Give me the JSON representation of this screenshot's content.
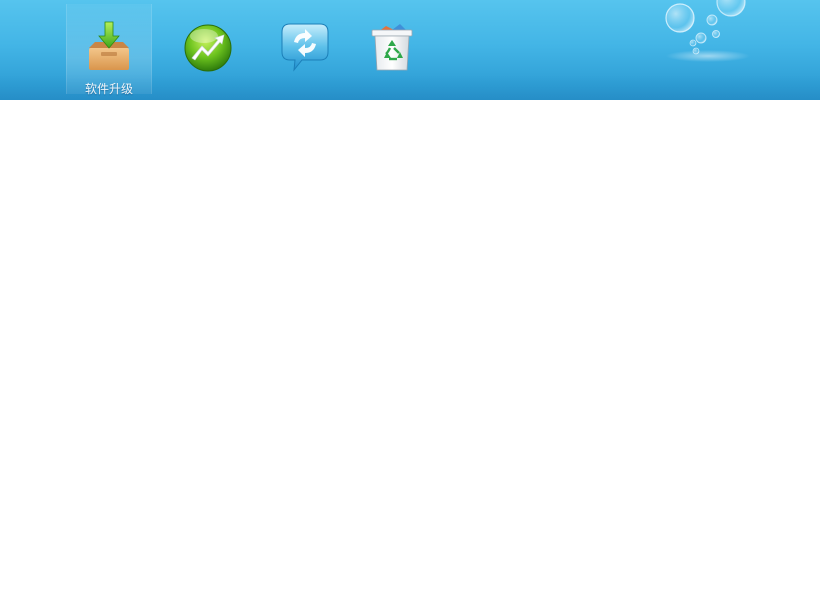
{
  "toolbar": {
    "items": [
      {
        "id": "software-upgrade",
        "label": "软件升级",
        "icon": "download-box-icon",
        "active": true
      },
      {
        "id": "speed-up",
        "label": "",
        "icon": "green-arrow-up-icon",
        "active": false
      },
      {
        "id": "chat-sync",
        "label": "",
        "icon": "refresh-bubble-icon",
        "active": false
      },
      {
        "id": "recycle",
        "label": "",
        "icon": "recycle-bin-icon",
        "active": false
      }
    ],
    "decoration": "bubbles-decoration"
  },
  "colors": {
    "toolbar_top": "#56c4ee",
    "toolbar_bottom": "#2b96cf",
    "label_text": "#ffffff",
    "content_bg": "#ffffff"
  }
}
